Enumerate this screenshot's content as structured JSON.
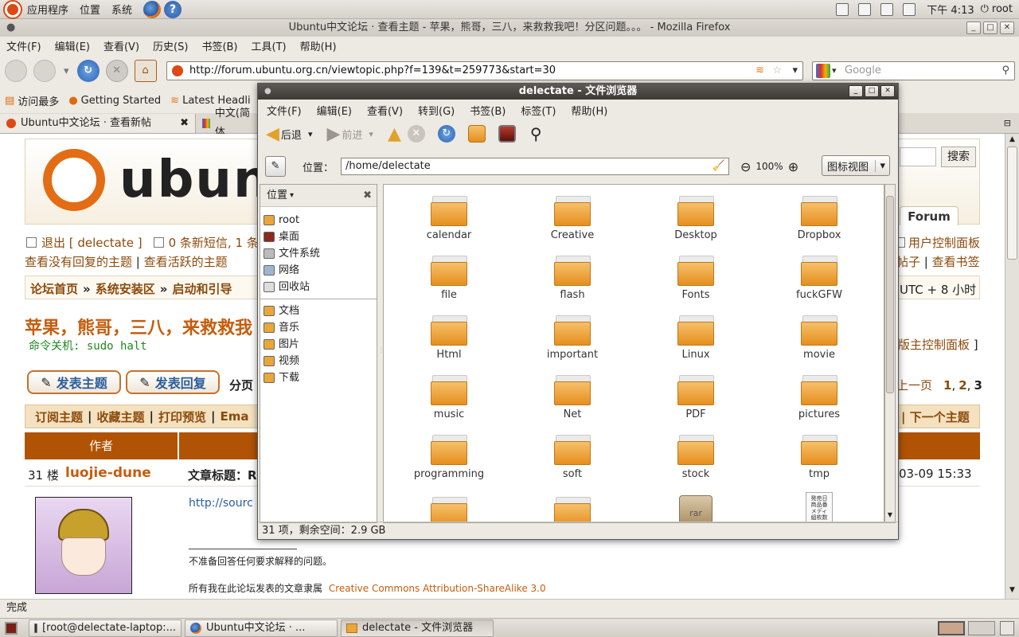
{
  "top_panel": {
    "menus": [
      "应用程序",
      "位置",
      "系统"
    ],
    "clock": "下午 4:13",
    "user": "root"
  },
  "firefox": {
    "title": "Ubuntu中文论坛 · 查看主题 - 苹果，熊哥，三八，来救救我吧！分区问题。。。 - Mozilla Firefox",
    "menu": [
      "文件(F)",
      "编辑(E)",
      "查看(V)",
      "历史(S)",
      "书签(B)",
      "工具(T)",
      "帮助(H)"
    ],
    "url": "http://forum.ubuntu.org.cn/viewtopic.php?f=139&t=259773&start=30",
    "search_placeholder": "Google",
    "bookmarks": [
      "访问最多",
      "Getting Started",
      "Latest Headli"
    ],
    "tabs": [
      "Ubuntu中文论坛 · 查看新帖",
      "中文(简体"
    ],
    "status": "完成"
  },
  "forum": {
    "logo_text": "ubuntu",
    "search_button": "搜索",
    "forum_tab": "Forum",
    "logout": "退出 [ delectate ]",
    "pm": "0 条新短信, 1 条",
    "ucp": "用户控制面板",
    "links_left": [
      "查看没有回复的主题",
      "查看活跃的主题"
    ],
    "links_right": [
      "帖子",
      "查看书签"
    ],
    "breadcrumb": [
      "论坛首页",
      "系统安装区",
      "启动和引导"
    ],
    "timezone": "UTC + 8 小时",
    "topic_title": "苹果，熊哥，三八，来救救我",
    "shutdown_tip": "命令关机: sudo halt",
    "mod_panel": "版主控制面板",
    "btn_new_topic": "发表主题",
    "btn_reply": "发表回复",
    "pages_label": "分页",
    "prev_page": "上一页",
    "pages": [
      "1",
      "2",
      "3"
    ],
    "actions": [
      "订阅主题",
      "收藏主题",
      "打印预览",
      "Ema"
    ],
    "next_topic": "下一个主题",
    "author_header": "作者",
    "post_floor": "31 楼",
    "post_author": "luojie-dune",
    "post_subject_label": "文章标题：R",
    "post_date": "03-09 15:33",
    "post_link": "http://sourc",
    "sig1": "不准备回答任何要求解释的问题。",
    "sig2_prefix": "所有我在此论坛发表的文章隶属",
    "sig2_link": "Creative Commons Attribution-ShareAlike 3.0"
  },
  "nautilus": {
    "title": "delectate - 文件浏览器",
    "menu": [
      "文件(F)",
      "编辑(E)",
      "查看(V)",
      "转到(G)",
      "书签(B)",
      "标签(T)",
      "帮助(H)"
    ],
    "back": "后退",
    "forward": "前进",
    "location_label": "位置：",
    "location": "/home/delectate",
    "zoom": "100%",
    "view_mode": "图标视图",
    "sidebar_title": "位置",
    "places": [
      "root",
      "桌面",
      "文件系统",
      "网络",
      "回收站"
    ],
    "bookmarks": [
      "文档",
      "音乐",
      "图片",
      "视频",
      "下载"
    ],
    "items": [
      "calendar",
      "Creative",
      "Desktop",
      "Dropbox",
      "file",
      "flash",
      "Fonts",
      "fuckGFW",
      "Html",
      "important",
      "Linux",
      "movie",
      "music",
      "Net",
      "PDF",
      "pictures",
      "programming",
      "soft",
      "stock",
      "tmp"
    ],
    "status": "31 项，剩余空间：2.9 GB"
  },
  "taskbar": {
    "tasks": [
      "[root@delectate-laptop:...",
      "Ubuntu中文论坛 · ...",
      "delectate - 文件浏览器"
    ]
  }
}
